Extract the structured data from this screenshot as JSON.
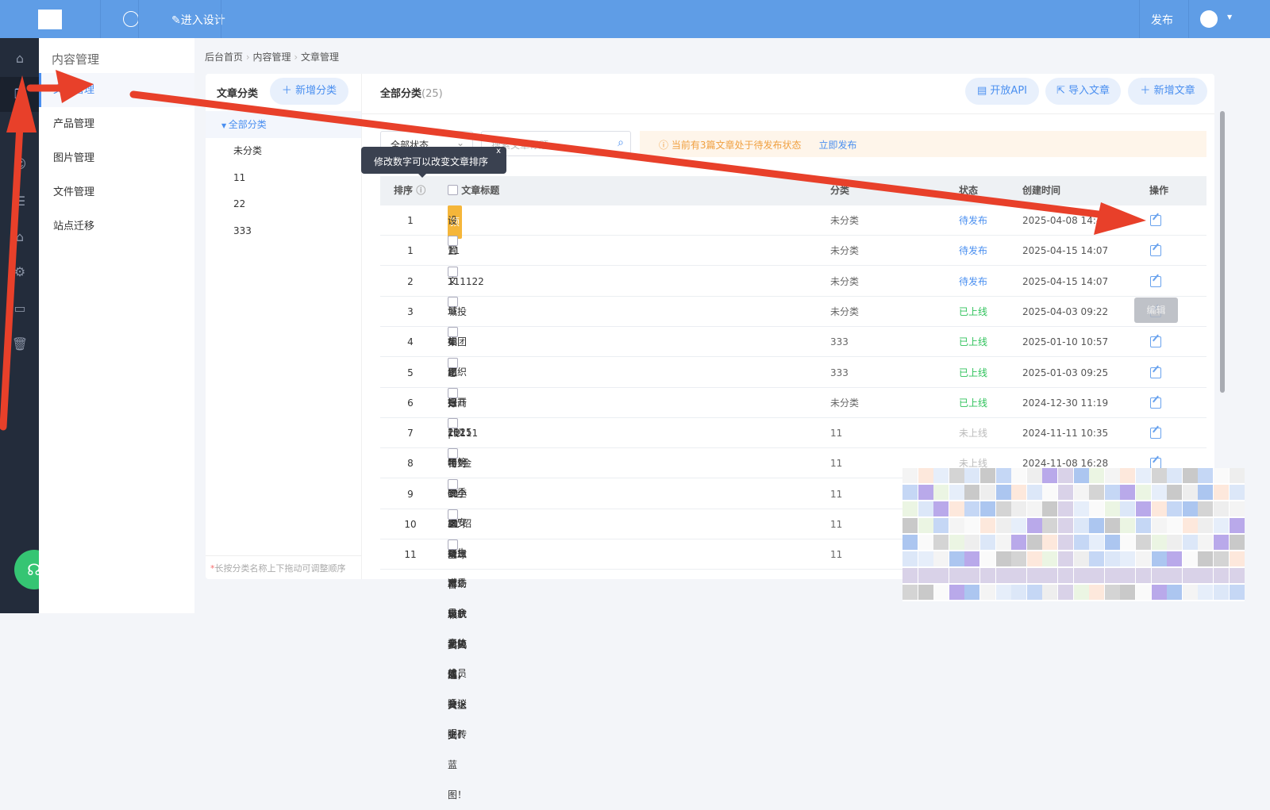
{
  "topbar": {
    "design_label": "进入设计",
    "publish_label": "发布"
  },
  "rail": {
    "icons": [
      "home-icon",
      "article-icon",
      "product-icon",
      "image-icon",
      "file-icon",
      "shop-icon",
      "settings-icon",
      "terminal-icon",
      "trash-icon"
    ]
  },
  "nav": {
    "title": "内容管理",
    "items": [
      {
        "label": "文章管理"
      },
      {
        "label": "产品管理"
      },
      {
        "label": "图片管理"
      },
      {
        "label": "文件管理"
      },
      {
        "label": "站点迁移"
      }
    ]
  },
  "breadcrumb": [
    "后台首页",
    "内容管理",
    "文章管理"
  ],
  "categories": {
    "title": "文章分类",
    "add_label": "新增分类",
    "items": [
      "全部分类",
      "未分类",
      "11",
      "22",
      "333"
    ],
    "hint_star": "*",
    "hint": "长按分类名称上下拖动可调整顺序"
  },
  "main": {
    "title": "全部分类",
    "count": "(25)",
    "api_label": "开放API",
    "import_label": "导入文章",
    "add_label": "新增文章"
  },
  "filter": {
    "status_value": "全部状态",
    "search_placeholder": "搜索文章标题",
    "notice": "当前有3篇文章处于待发布状态",
    "notice_action": "立即发布"
  },
  "tooltip": {
    "text": "修改数字可以改变文章排序",
    "close": "x"
  },
  "edit_tooltip": "编辑",
  "table": {
    "headers": {
      "order": "排序",
      "title": "文章标题",
      "category": "分类",
      "status": "状态",
      "created": "创建时间",
      "actions": "操作"
    },
    "top_badge": "顶",
    "rows": [
      {
        "order": "1",
        "title": "设置文章标题",
        "category": "未分类",
        "status": "待发布",
        "created": "2025-04-08 14:48",
        "top": true
      },
      {
        "order": "1",
        "title": "11",
        "category": "未分类",
        "status": "待发布",
        "created": "2025-04-15 14:07"
      },
      {
        "order": "2",
        "title": "111122",
        "category": "未分类",
        "status": "待发布",
        "created": "2025-04-15 14:07"
      },
      {
        "order": "3",
        "title": "城投集团组织召开2025年第一季度安全生产委员会全体成员会议",
        "category": "未分类",
        "status": "已上线",
        "created": "2025-04-03 09:22"
      },
      {
        "order": "4",
        "title": "如何提升睡眠质量减少无效睡眠?",
        "category": "333",
        "status": "已上线",
        "created": "2025-01-10 10:57"
      },
      {
        "order": "5",
        "title": "您好",
        "category": "333",
        "status": "已上线",
        "created": "2025-01-03 09:25"
      },
      {
        "order": "6",
        "title": "招商 | 沙特“金砖小镇”招商启幕！启航新机遇，共绘金砖蓝图！",
        "category": "未分类",
        "status": "已上线",
        "created": "2024-12-30 11:19"
      },
      {
        "order": "7",
        "title": "11111",
        "category": "11",
        "status": "未上线",
        "created": "2024-11-11 10:35"
      },
      {
        "order": "8",
        "title": "铅封安全之疑：市场现状与隐忧",
        "category": "11",
        "status": "未上线",
        "created": "2024-11-08 16:28"
      },
      {
        "order": "9",
        "title": "11",
        "category": "11",
        "status": "",
        "created": ""
      },
      {
        "order": "10",
        "title": "11",
        "category": "11",
        "status": "",
        "created": ""
      },
      {
        "order": "11",
        "title": "全球首颗！武大造，又上天！",
        "category": "11",
        "status": "",
        "created": ""
      }
    ]
  },
  "colors": {
    "topbar": "#5f9de6",
    "accent": "#4a8ff0",
    "pending": "#4a8ff0",
    "online": "#2fc25b",
    "offline": "#bbbbbb",
    "annotation": "#e8402a"
  }
}
